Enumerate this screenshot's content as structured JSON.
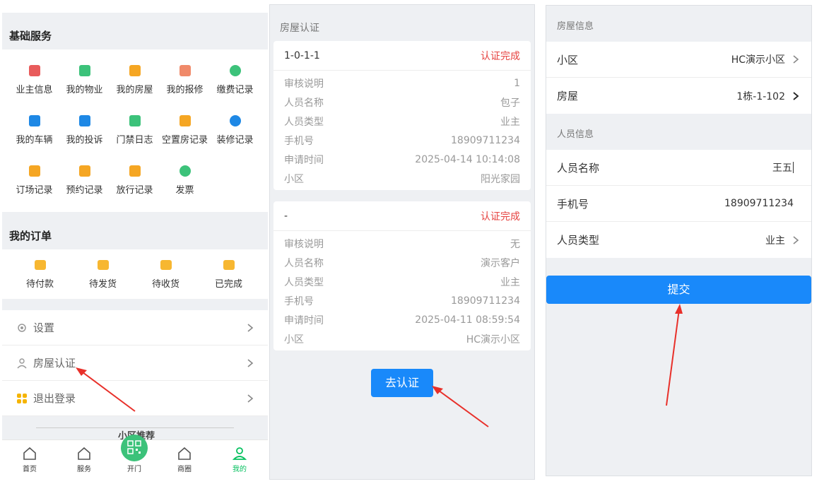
{
  "left_panel": {
    "basic_services": {
      "title": "基础服务",
      "items": [
        {
          "label": "业主信息",
          "icon": "owner-icon",
          "color": "#e85b5b"
        },
        {
          "label": "我的物业",
          "icon": "building-icon",
          "color": "#3cc27a"
        },
        {
          "label": "我的房屋",
          "icon": "house-icon",
          "color": "#f5a623"
        },
        {
          "label": "我的报修",
          "icon": "repair-icon",
          "color": "#f08a6a"
        },
        {
          "label": "缴费记录",
          "icon": "payment-icon",
          "color": "#3cc27a"
        },
        {
          "label": "我的车辆",
          "icon": "parking-icon",
          "color": "#1e88e5"
        },
        {
          "label": "我的投诉",
          "icon": "complaint-icon",
          "color": "#1e88e5"
        },
        {
          "label": "门禁日志",
          "icon": "access-log-icon",
          "color": "#3cc27a"
        },
        {
          "label": "空置房记录",
          "icon": "vacant-icon",
          "color": "#f5a623"
        },
        {
          "label": "装修记录",
          "icon": "decoration-icon",
          "color": "#1e88e5"
        },
        {
          "label": "订场记录",
          "icon": "booking-icon",
          "color": "#f5a623"
        },
        {
          "label": "预约记录",
          "icon": "appointment-icon",
          "color": "#f5a623"
        },
        {
          "label": "放行记录",
          "icon": "release-icon",
          "color": "#f5a623"
        },
        {
          "label": "发票",
          "icon": "invoice-icon",
          "color": "#3cc27a"
        }
      ]
    },
    "orders": {
      "title": "我的订单",
      "items": [
        {
          "label": "待付款",
          "icon": "wallet-icon"
        },
        {
          "label": "待发货",
          "icon": "box-icon"
        },
        {
          "label": "待收货",
          "icon": "truck-icon"
        },
        {
          "label": "已完成",
          "icon": "done-icon"
        }
      ]
    },
    "menu": [
      {
        "label": "设置",
        "icon": "gear-icon"
      },
      {
        "label": "房屋认证",
        "icon": "person-icon"
      },
      {
        "label": "退出登录",
        "icon": "logout-icon"
      }
    ],
    "recommend_label": "小区推荐",
    "tabbar": [
      {
        "label": "首页",
        "icon": "home-icon"
      },
      {
        "label": "服务",
        "icon": "service-icon"
      },
      {
        "label": "开门",
        "icon": "qrcode-icon"
      },
      {
        "label": "商圈",
        "icon": "shop-icon"
      },
      {
        "label": "我的",
        "icon": "user-icon"
      }
    ]
  },
  "middle_panel": {
    "title": "房屋认证",
    "records": [
      {
        "house": "1-0-1-1",
        "status": "认证完成",
        "rows": [
          {
            "k": "审核说明",
            "v": "1"
          },
          {
            "k": "人员名称",
            "v": "包子"
          },
          {
            "k": "人员类型",
            "v": "业主"
          },
          {
            "k": "手机号",
            "v": "18909711234"
          },
          {
            "k": "申请时间",
            "v": "2025-04-14 10:14:08"
          },
          {
            "k": "小区",
            "v": "阳光家园"
          }
        ]
      },
      {
        "house": "-",
        "status": "认证完成",
        "rows": [
          {
            "k": "审核说明",
            "v": "无"
          },
          {
            "k": "人员名称",
            "v": "演示客户"
          },
          {
            "k": "人员类型",
            "v": "业主"
          },
          {
            "k": "手机号",
            "v": "18909711234"
          },
          {
            "k": "申请时间",
            "v": "2025-04-11 08:59:54"
          },
          {
            "k": "小区",
            "v": "HC演示小区"
          }
        ]
      }
    ],
    "button": "去认证"
  },
  "right_panel": {
    "house_info_title": "房屋信息",
    "community_label": "小区",
    "community_value": "HC演示小区",
    "house_label": "房屋",
    "house_value": "1栋-1-102",
    "person_info_title": "人员信息",
    "name_label": "人员名称",
    "name_value": "王五",
    "phone_label": "手机号",
    "phone_value": "18909711234",
    "type_label": "人员类型",
    "type_value": "业主",
    "submit": "提交"
  },
  "colors": {
    "primary": "#1989fa",
    "success_green": "#07c160",
    "status_red": "#e64340",
    "arrow_red": "#e8302a"
  }
}
